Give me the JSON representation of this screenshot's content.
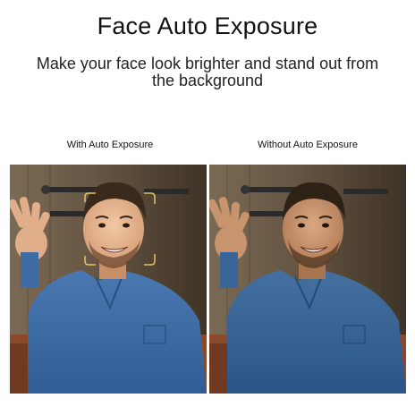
{
  "header": {
    "title": "Face Auto Exposure",
    "subtitle": "Make your face look brighter and stand out from the background"
  },
  "comparison": {
    "left_label": "With Auto Exposure",
    "right_label": "Without Auto Exposure"
  },
  "colors": {
    "face_detect_box": "#e8c26a",
    "shirt": "#3f6fa8",
    "wall": "#6a5a48"
  }
}
